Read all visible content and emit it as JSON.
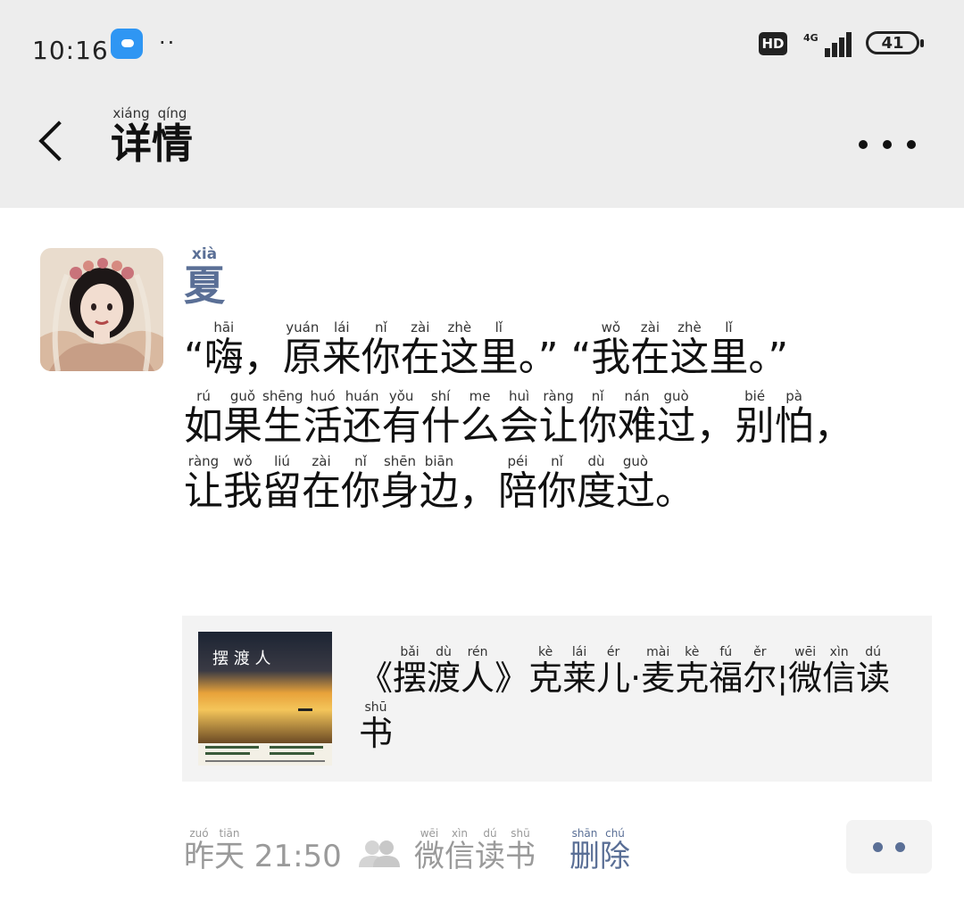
{
  "status_bar": {
    "time": "10:16",
    "hd": "HD",
    "network": "4G",
    "battery": "41"
  },
  "header": {
    "title": [
      {
        "c": "详",
        "p": "xiáng"
      },
      {
        "c": "情",
        "p": "qíng"
      }
    ]
  },
  "post": {
    "author": [
      {
        "c": "夏",
        "p": "xià"
      }
    ],
    "paragraphs": [
      [
        {
          "c": "“",
          "p": ""
        },
        {
          "c": "嗨",
          "p": "hāi"
        },
        {
          "c": "，",
          "p": ""
        },
        {
          "c": "原",
          "p": "yuán"
        },
        {
          "c": "来",
          "p": "lái"
        },
        {
          "c": "你",
          "p": "nǐ"
        },
        {
          "c": "在",
          "p": "zài"
        },
        {
          "c": "这",
          "p": "zhè"
        },
        {
          "c": "里",
          "p": "lǐ"
        },
        {
          "c": "。",
          "p": ""
        },
        {
          "c": "”",
          "p": ""
        },
        {
          "c": " ",
          "p": ""
        },
        {
          "c": "“",
          "p": ""
        },
        {
          "c": "我",
          "p": "wǒ"
        },
        {
          "c": "在",
          "p": "zài"
        },
        {
          "c": "这",
          "p": "zhè"
        },
        {
          "c": "里",
          "p": "lǐ"
        },
        {
          "c": "。",
          "p": ""
        },
        {
          "c": "”",
          "p": ""
        }
      ],
      [
        {
          "c": "如",
          "p": "rú"
        },
        {
          "c": "果",
          "p": "guǒ"
        },
        {
          "c": "生",
          "p": "shēng"
        },
        {
          "c": "活",
          "p": "huó"
        },
        {
          "c": "还",
          "p": "huán"
        },
        {
          "c": "有",
          "p": "yǒu"
        },
        {
          "c": "什",
          "p": "shí"
        },
        {
          "c": "么",
          "p": "me"
        },
        {
          "c": "会",
          "p": "huì"
        },
        {
          "c": "让",
          "p": "ràng"
        },
        {
          "c": "你",
          "p": "nǐ"
        },
        {
          "c": "难",
          "p": "nán"
        },
        {
          "c": "过",
          "p": "guò"
        },
        {
          "c": "，",
          "p": ""
        },
        {
          "c": "别",
          "p": "bié"
        },
        {
          "c": "怕",
          "p": "pà"
        },
        {
          "c": "，",
          "p": ""
        },
        {
          "c": "让",
          "p": "ràng"
        },
        {
          "c": "我",
          "p": "wǒ"
        },
        {
          "c": "留",
          "p": "liú"
        },
        {
          "c": "在",
          "p": "zài"
        },
        {
          "c": "你",
          "p": "nǐ"
        },
        {
          "c": "身",
          "p": "shēn"
        },
        {
          "c": "边",
          "p": "biān"
        },
        {
          "c": "，",
          "p": ""
        },
        {
          "c": "陪",
          "p": "péi"
        },
        {
          "c": "你",
          "p": "nǐ"
        },
        {
          "c": "度",
          "p": "dù"
        },
        {
          "c": "过",
          "p": "guò"
        },
        {
          "c": "。",
          "p": ""
        }
      ]
    ]
  },
  "share_card": {
    "book_cover_title": "摆 渡 人",
    "title": [
      {
        "c": "《",
        "p": ""
      },
      {
        "c": "摆",
        "p": "bǎi"
      },
      {
        "c": "渡",
        "p": "dù"
      },
      {
        "c": "人",
        "p": "rén"
      },
      {
        "c": "》",
        "p": ""
      },
      {
        "c": "克",
        "p": "kè"
      },
      {
        "c": "莱",
        "p": "lái"
      },
      {
        "c": "儿",
        "p": "ér"
      },
      {
        "c": "·",
        "p": ""
      },
      {
        "c": "麦",
        "p": "mài"
      },
      {
        "c": "克",
        "p": "kè"
      },
      {
        "c": "福",
        "p": "fú"
      },
      {
        "c": "尔",
        "p": "ěr"
      },
      {
        "c": "¦",
        "p": ""
      },
      {
        "c": "微",
        "p": "wēi"
      },
      {
        "c": "信",
        "p": "xìn"
      },
      {
        "c": "读",
        "p": "dú"
      },
      {
        "c": "书",
        "p": "shū"
      }
    ]
  },
  "footer": {
    "time": [
      {
        "c": "昨",
        "p": "zuó"
      },
      {
        "c": "天",
        "p": "tiān"
      },
      {
        "c": " 21:50",
        "p": ""
      }
    ],
    "source": [
      {
        "c": "微",
        "p": "wēi"
      },
      {
        "c": "信",
        "p": "xìn"
      },
      {
        "c": "读",
        "p": "dú"
      },
      {
        "c": "书",
        "p": "shū"
      }
    ],
    "delete": [
      {
        "c": "删",
        "p": "shān"
      },
      {
        "c": "除",
        "p": "chú"
      }
    ]
  },
  "colors": {
    "link": "#5a6f96",
    "header_bg": "#ededed",
    "muted": "#9a9a9a"
  }
}
